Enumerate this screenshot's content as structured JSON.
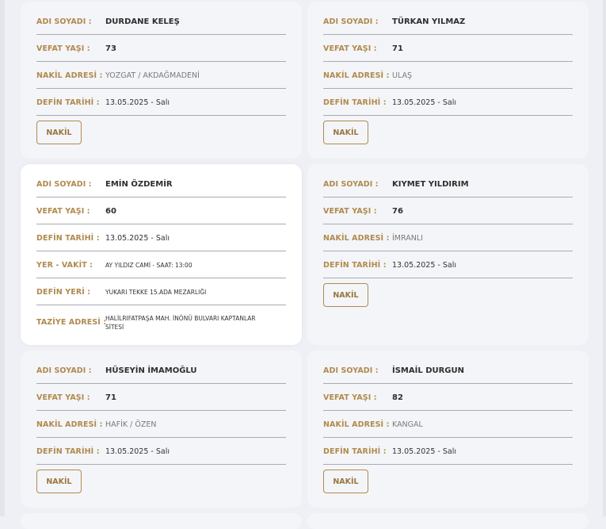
{
  "cards": [
    {
      "rows": [
        {
          "label": "ADI SOYADI :",
          "value": "DURDANE KELEŞ"
        },
        {
          "label": "VEFAT YAŞI :",
          "value": "73"
        },
        {
          "label": "NAKİL ADRESİ :",
          "value": "YOZGAT / AKDAĞMADENİ"
        },
        {
          "label": "DEFİN TARİHİ :",
          "value": "13.05.2025 - Salı"
        }
      ],
      "button": "NAKİL"
    },
    {
      "rows": [
        {
          "label": "ADI SOYADI :",
          "value": "TÜRKAN YILMAZ"
        },
        {
          "label": "VEFAT YAŞI :",
          "value": "71"
        },
        {
          "label": "NAKİL ADRESİ :",
          "value": "ULAŞ"
        },
        {
          "label": "DEFİN TARİHİ :",
          "value": "13.05.2025 - Salı"
        }
      ],
      "button": "NAKİL"
    },
    {
      "rows": [
        {
          "label": "ADI SOYADI :",
          "value": "EMİN ÖZDEMİR"
        },
        {
          "label": "VEFAT YAŞI :",
          "value": "60"
        },
        {
          "label": "DEFİN TARİHİ :",
          "value": "13.05.2025 - Salı"
        },
        {
          "label": "YER - VAKİT :",
          "value": "AY YILDIZ CAMİ - SAAT: 13:00"
        },
        {
          "label": "DEFİN YERİ :",
          "value": "YUKARI TEKKE 15.ADA MEZARLIĞI"
        },
        {
          "label": "TAZİYE ADRESİ :",
          "value": "HALİLRIFATPAŞA MAH. İNÖNÜ BULVARI KAPTANLAR SİTESİ"
        }
      ]
    },
    {
      "rows": [
        {
          "label": "ADI SOYADI :",
          "value": "KIYMET YILDIRIM"
        },
        {
          "label": "VEFAT YAŞI :",
          "value": "76"
        },
        {
          "label": "NAKİL ADRESİ :",
          "value": "İMRANLI"
        },
        {
          "label": "DEFİN TARİHİ :",
          "value": "13.05.2025 - Salı"
        }
      ],
      "button": "NAKİL"
    },
    {
      "rows": [
        {
          "label": "ADI SOYADI :",
          "value": "HÜSEYİN İMAMOĞLU"
        },
        {
          "label": "VEFAT YAŞI :",
          "value": "71"
        },
        {
          "label": "NAKİL ADRESİ :",
          "value": "HAFİK / ÖZEN"
        },
        {
          "label": "DEFİN TARİHİ :",
          "value": "13.05.2025 - Salı"
        }
      ],
      "button": "NAKİL"
    },
    {
      "rows": [
        {
          "label": "ADI SOYADI :",
          "value": "İSMAİL DURGUN"
        },
        {
          "label": "VEFAT YAŞI :",
          "value": "82"
        },
        {
          "label": "NAKİL ADRESİ :",
          "value": "KANGAL"
        },
        {
          "label": "DEFİN TARİHİ :",
          "value": "13.05.2025 - Salı"
        }
      ],
      "button": "NAKİL"
    }
  ],
  "colors": {
    "label": "#b08a4e",
    "card_bg": "#f4f5f8",
    "page_bg": "#eef0f5",
    "divider": "#a9abb2"
  }
}
